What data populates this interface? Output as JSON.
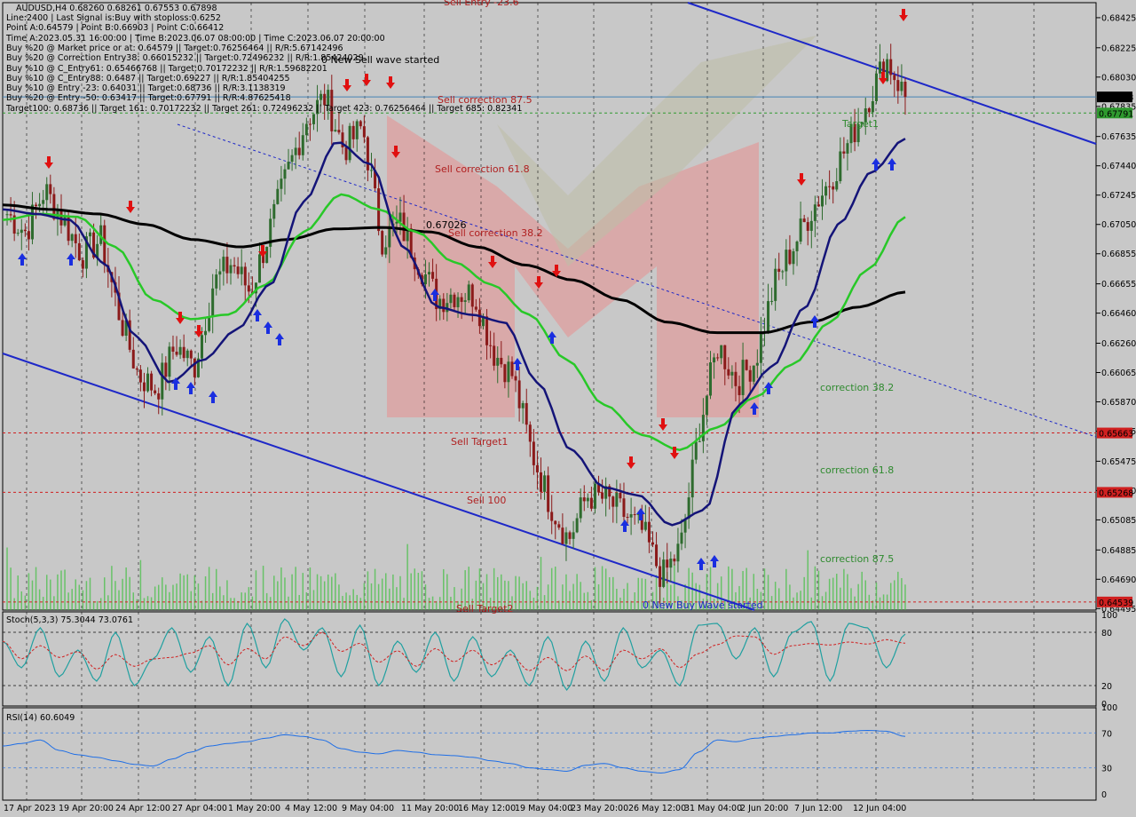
{
  "header": {
    "symbol_line": "AUDUSD,H4  0.68260 0.68261 0.67553 0.67898",
    "lines": [
      "Line:2400 | Last Signal is:Buy with stoploss:0.6252",
      "Point A:0.64579 | Point B:0.66903 | Point C:0.66412",
      "Time A:2023.05.31 16:00:00 | Time B:2023.06.07 08:00:00 | Time C:2023.06.07 20:00:00",
      "Buy %20 @ Market price or at: 0.64579 || Target:0.76256464 || R/R:5.67142496",
      "Buy %20 @ Correction Entry38: 0.66015232 || Target:0.72496232 || R/R:1.85424029",
      "Buy %10 @ C_Entry61: 0.65466768 || Target:0.70172232 || R/R:1.59682201",
      "Buy %10 @ C_Entry88: 0.6487 || Target:0.69227 || R/R:1.85404255",
      "Buy %10 @ Entry -23: 0.64031 || Target:0.68736 || R/R:3.1138319",
      "Buy %20 @ Entry -50: 0.63417 || Target:0.67791 || R/R:4.87625418",
      "Target100: 0.68736 || Target 161: 0.70172232 || Target 261: 0.72496232 || Target 423: 0.76256464 || Target 685: 0.82341"
    ]
  },
  "annotations": {
    "sell_entry": "Sell Entry -23.6",
    "new_sell_wave": "0 New Sell wave started",
    "sell_correction_875": "Sell correction 87.5",
    "sell_correction_618": "Sell correction 61.8",
    "sell_correction_382": "Sell correction 38.2",
    "point_label": "0.67026",
    "sell_target1": "Sell Target1",
    "sell_100": "Sell 100",
    "sell_target2": "Sell Target2",
    "new_buy_wave": "0 New Buy Wave started",
    "correction_382": "correction 38.2",
    "correction_618": "correction 61.8",
    "correction_875": "correction 87.5",
    "target1": "Target1"
  },
  "price_tags": [
    {
      "value": 0.67898,
      "label": "0.67898",
      "color": "#000000",
      "text_color": "#ffffff"
    },
    {
      "value": 0.67791,
      "label": "0.67791",
      "color": "#2e9a2e",
      "text_color": "#ffffff"
    },
    {
      "value": 0.65663,
      "label": "0.65663",
      "color": "#d02020",
      "text_color": "#ffffff"
    },
    {
      "value": 0.65268,
      "label": "0.65268",
      "color": "#d02020",
      "text_color": "#ffffff"
    },
    {
      "value": 0.64539,
      "label": "0.64539",
      "color": "#d02020",
      "text_color": "#ffffff"
    }
  ],
  "indicators": {
    "stoch_label": "Stoch(5,3,3) 75.3044 73.0761",
    "stoch_levels": [
      "100",
      "80",
      "20",
      "0"
    ],
    "rsi_label": "RSI(14) 60.6049",
    "rsi_levels": [
      "100",
      "70",
      "30",
      "0"
    ]
  },
  "colors": {
    "background": "#c8c8c8",
    "bull_candle": "#2e6b2e",
    "bear_candle": "#8b1a1a",
    "ma_fast": "#141478",
    "ma_mid": "#28c828",
    "ma_slow": "#000000",
    "channel": "#1e28c8",
    "stoch_main": "#20a0a0",
    "stoch_signal": "#d02020",
    "rsi": "#1e6ee6",
    "buy_arrow": "#1a2ee0",
    "sell_arrow": "#e01010"
  },
  "chart_data": {
    "type": "candlestick",
    "symbol": "AUDUSD",
    "timeframe": "H4",
    "ylim": [
      0.64485,
      0.68525
    ],
    "y_ticks": [
      "0.68425",
      "0.68225",
      "0.68030",
      "0.67835",
      "0.67635",
      "0.67440",
      "0.67245",
      "0.67050",
      "0.66855",
      "0.66655",
      "0.66460",
      "0.66260",
      "0.66065",
      "0.65870",
      "0.65675",
      "0.65475",
      "0.65280",
      "0.65085",
      "0.64885",
      "0.64690",
      "0.64495"
    ],
    "x_ticks": [
      "17 Apr 2023",
      "19 Apr 20:00",
      "24 Apr 12:00",
      "27 Apr 04:00",
      "1 May 20:00",
      "4 May 12:00",
      "9 May 04:00",
      "11 May 20:00",
      "16 May 12:00",
      "19 May 04:00",
      "23 May 20:00",
      "26 May 12:00",
      "31 May 04:00",
      "2 Jun 20:00",
      "7 Jun 12:00",
      "12 Jun 04:00"
    ],
    "close_anchors": [
      0.6712,
      0.67,
      0.6728,
      0.6708,
      0.6685,
      0.6695,
      0.6645,
      0.6605,
      0.6595,
      0.6625,
      0.661,
      0.6665,
      0.668,
      0.666,
      0.67,
      0.674,
      0.6775,
      0.679,
      0.6755,
      0.677,
      0.6695,
      0.6705,
      0.668,
      0.6655,
      0.666,
      0.6658,
      0.662,
      0.6605,
      0.6555,
      0.652,
      0.6495,
      0.6525,
      0.6522,
      0.6512,
      0.65,
      0.647,
      0.649,
      0.657,
      0.6625,
      0.66,
      0.6615,
      0.6665,
      0.669,
      0.6715,
      0.6735,
      0.676,
      0.6788,
      0.6815,
      0.679
    ],
    "stoch_main": [
      70,
      40,
      85,
      30,
      60,
      25,
      80,
      20,
      50,
      85,
      35,
      75,
      20,
      90,
      40,
      95,
      60,
      85,
      30,
      88,
      20,
      70,
      35,
      80,
      25,
      75,
      30,
      60,
      20,
      75,
      15,
      70,
      25,
      85,
      40,
      60,
      20,
      88,
      90,
      50,
      85,
      30,
      80,
      92,
      25,
      90,
      85,
      40,
      78
    ],
    "rsi": [
      55,
      58,
      62,
      50,
      45,
      42,
      38,
      34,
      32,
      40,
      48,
      55,
      58,
      60,
      64,
      68,
      66,
      62,
      52,
      48,
      46,
      50,
      48,
      45,
      44,
      42,
      38,
      35,
      30,
      28,
      26,
      33,
      35,
      30,
      26,
      24,
      28,
      48,
      62,
      60,
      64,
      66,
      68,
      70,
      70,
      72,
      73,
      72,
      66
    ],
    "ma_fast_anchors": [
      0.6715,
      0.6712,
      0.6708,
      0.668,
      0.663,
      0.66,
      0.6615,
      0.6635,
      0.6665,
      0.672,
      0.676,
      0.6745,
      0.669,
      0.665,
      0.6645,
      0.664,
      0.66,
      0.6555,
      0.653,
      0.6525,
      0.6505,
      0.6515,
      0.6585,
      0.661,
      0.665,
      0.6705,
      0.674,
      0.6762
    ],
    "ma_mid_anchors": [
      0.6708,
      0.6712,
      0.671,
      0.669,
      0.6655,
      0.6642,
      0.6645,
      0.6665,
      0.67,
      0.6725,
      0.6715,
      0.67,
      0.668,
      0.6665,
      0.6645,
      0.6615,
      0.6585,
      0.6565,
      0.6555,
      0.657,
      0.659,
      0.6612,
      0.664,
      0.6675,
      0.671
    ],
    "ma_slow_anchors": [
      0.6718,
      0.6715,
      0.6712,
      0.6705,
      0.6695,
      0.669,
      0.6695,
      0.6702,
      0.6703,
      0.67,
      0.669,
      0.6678,
      0.6668,
      0.6655,
      0.664,
      0.6633,
      0.6633,
      0.664,
      0.665,
      0.666
    ],
    "levels": [
      {
        "name": "current",
        "value": 0.67898,
        "style": "solid",
        "color": "#4682b4"
      },
      {
        "name": "target",
        "value": 0.67791,
        "style": "dashed",
        "color": "#2e9a2e"
      },
      {
        "name": "sell_target1",
        "value": 0.65663,
        "style": "dashed",
        "color": "#d02020"
      },
      {
        "name": "sell_100",
        "value": 0.65268,
        "style": "dashed",
        "color": "#d02020"
      },
      {
        "name": "sell_target2",
        "value": 0.64539,
        "style": "dashed",
        "color": "#d02020"
      }
    ]
  }
}
